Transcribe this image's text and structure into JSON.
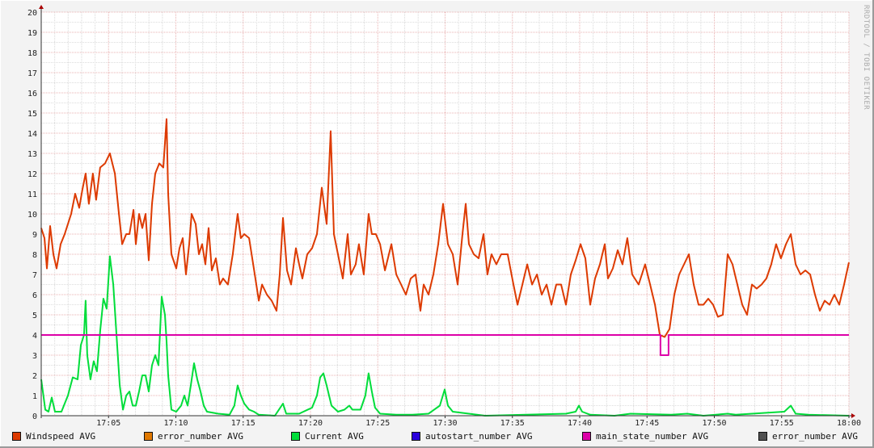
{
  "watermark": "RRDTOOL / TOBI OETIKER",
  "colors": {
    "windspeed": "#dd3a00",
    "error_number_1": "#e07800",
    "current": "#00dd3a",
    "autostart": "#2a00dd",
    "main_state": "#dd00a8",
    "error_number_2": "#505050",
    "background": "#f3f3f3",
    "plot": "#ffffff"
  },
  "legend": [
    {
      "label": "Windspeed AVG",
      "color_key": "windspeed"
    },
    {
      "label": "error_number AVG",
      "color_key": "error_number_1"
    },
    {
      "label": "Current AVG",
      "color_key": "current"
    },
    {
      "label": "autostart_number AVG",
      "color_key": "autostart"
    },
    {
      "label": "main_state_number AVG",
      "color_key": "main_state"
    },
    {
      "label": "error_number AVG",
      "color_key": "error_number_2"
    }
  ],
  "chart_data": {
    "type": "line",
    "title": "",
    "xlabel": "",
    "ylabel": "",
    "x_unit": "minutes after 17:00",
    "xlim": [
      0,
      60
    ],
    "ylim": [
      0,
      20
    ],
    "grid": true,
    "legend_position": "bottom",
    "x_ticks": [
      {
        "t": 5,
        "label": "17:05"
      },
      {
        "t": 10,
        "label": "17:10"
      },
      {
        "t": 15,
        "label": "17:15"
      },
      {
        "t": 20,
        "label": "17:20"
      },
      {
        "t": 25,
        "label": "17:25"
      },
      {
        "t": 30,
        "label": "17:30"
      },
      {
        "t": 35,
        "label": "17:35"
      },
      {
        "t": 40,
        "label": "17:40"
      },
      {
        "t": 45,
        "label": "17:45"
      },
      {
        "t": 50,
        "label": "17:50"
      },
      {
        "t": 55,
        "label": "17:55"
      },
      {
        "t": 60,
        "label": "18:00"
      }
    ],
    "y_ticks": [
      "0",
      "1",
      "2",
      "3",
      "4",
      "5",
      "6",
      "7",
      "8",
      "9",
      "10",
      "11",
      "12",
      "13",
      "14",
      "15",
      "16",
      "17",
      "18",
      "19",
      "20"
    ],
    "series": [
      {
        "name": "Windspeed AVG",
        "color_key": "windspeed",
        "points": [
          [
            0,
            9.3
          ],
          [
            0.24,
            8.8
          ],
          [
            0.42,
            7.3
          ],
          [
            0.66,
            9.4
          ],
          [
            0.9,
            8
          ],
          [
            1.14,
            7.3
          ],
          [
            1.44,
            8.5
          ],
          [
            1.74,
            9
          ],
          [
            2.22,
            10
          ],
          [
            2.52,
            11
          ],
          [
            2.82,
            10.3
          ],
          [
            3.06,
            11.2
          ],
          [
            3.3,
            12
          ],
          [
            3.54,
            10.5
          ],
          [
            3.84,
            12
          ],
          [
            4.08,
            10.7
          ],
          [
            4.38,
            12.3
          ],
          [
            4.74,
            12.5
          ],
          [
            5.1,
            13
          ],
          [
            5.47,
            12
          ],
          [
            5.77,
            10
          ],
          [
            6.01,
            8.5
          ],
          [
            6.31,
            9
          ],
          [
            6.55,
            9
          ],
          [
            6.85,
            10.2
          ],
          [
            7.03,
            8.5
          ],
          [
            7.27,
            10
          ],
          [
            7.51,
            9.3
          ],
          [
            7.75,
            10
          ],
          [
            7.99,
            7.7
          ],
          [
            8.23,
            10.5
          ],
          [
            8.47,
            12
          ],
          [
            8.77,
            12.5
          ],
          [
            9.07,
            12.3
          ],
          [
            9.31,
            14.7
          ],
          [
            9.43,
            11
          ],
          [
            9.67,
            8
          ],
          [
            10.03,
            7.3
          ],
          [
            10.27,
            8.3
          ],
          [
            10.51,
            8.8
          ],
          [
            10.75,
            7
          ],
          [
            10.99,
            8.5
          ],
          [
            11.17,
            10
          ],
          [
            11.47,
            9.5
          ],
          [
            11.71,
            8
          ],
          [
            11.95,
            8.5
          ],
          [
            12.19,
            7.5
          ],
          [
            12.43,
            9.3
          ],
          [
            12.67,
            7.2
          ],
          [
            12.97,
            7.8
          ],
          [
            13.27,
            6.5
          ],
          [
            13.51,
            6.8
          ],
          [
            13.87,
            6.5
          ],
          [
            14.23,
            8
          ],
          [
            14.59,
            10
          ],
          [
            14.83,
            8.8
          ],
          [
            15.08,
            9
          ],
          [
            15.44,
            8.8
          ],
          [
            15.86,
            7
          ],
          [
            16.16,
            5.7
          ],
          [
            16.4,
            6.5
          ],
          [
            16.76,
            6
          ],
          [
            17.12,
            5.7
          ],
          [
            17.48,
            5.2
          ],
          [
            17.72,
            7
          ],
          [
            17.96,
            9.8
          ],
          [
            18.26,
            7.2
          ],
          [
            18.56,
            6.5
          ],
          [
            18.92,
            8.3
          ],
          [
            19.16,
            7.5
          ],
          [
            19.4,
            6.8
          ],
          [
            19.76,
            8
          ],
          [
            20.12,
            8.3
          ],
          [
            20.48,
            9
          ],
          [
            20.84,
            11.3
          ],
          [
            21.2,
            9.5
          ],
          [
            21.5,
            14.1
          ],
          [
            21.74,
            9
          ],
          [
            22.04,
            8
          ],
          [
            22.4,
            6.8
          ],
          [
            22.76,
            9
          ],
          [
            23,
            7
          ],
          [
            23.36,
            7.5
          ],
          [
            23.6,
            8.5
          ],
          [
            23.96,
            7
          ],
          [
            24.32,
            10
          ],
          [
            24.56,
            9
          ],
          [
            24.86,
            9
          ],
          [
            25.17,
            8.5
          ],
          [
            25.53,
            7.2
          ],
          [
            26.01,
            8.5
          ],
          [
            26.37,
            7
          ],
          [
            26.73,
            6.5
          ],
          [
            27.09,
            6
          ],
          [
            27.45,
            6.8
          ],
          [
            27.81,
            7
          ],
          [
            28.17,
            5.2
          ],
          [
            28.41,
            6.5
          ],
          [
            28.77,
            6
          ],
          [
            29.13,
            7
          ],
          [
            29.49,
            8.5
          ],
          [
            29.85,
            10.5
          ],
          [
            30.21,
            8.5
          ],
          [
            30.57,
            8
          ],
          [
            30.93,
            6.5
          ],
          [
            31.29,
            9
          ],
          [
            31.53,
            10.5
          ],
          [
            31.77,
            8.5
          ],
          [
            32.13,
            8
          ],
          [
            32.49,
            7.8
          ],
          [
            32.85,
            9
          ],
          [
            33.15,
            7
          ],
          [
            33.45,
            8
          ],
          [
            33.81,
            7.5
          ],
          [
            34.17,
            8
          ],
          [
            34.65,
            8
          ],
          [
            35.02,
            6.7
          ],
          [
            35.38,
            5.5
          ],
          [
            35.74,
            6.5
          ],
          [
            36.1,
            7.5
          ],
          [
            36.46,
            6.5
          ],
          [
            36.82,
            7
          ],
          [
            37.18,
            6
          ],
          [
            37.54,
            6.5
          ],
          [
            37.9,
            5.5
          ],
          [
            38.26,
            6.5
          ],
          [
            38.62,
            6.5
          ],
          [
            38.98,
            5.5
          ],
          [
            39.34,
            7
          ],
          [
            39.7,
            7.7
          ],
          [
            40.06,
            8.5
          ],
          [
            40.42,
            7.8
          ],
          [
            40.78,
            5.5
          ],
          [
            41.14,
            6.8
          ],
          [
            41.5,
            7.5
          ],
          [
            41.86,
            8.5
          ],
          [
            42.1,
            6.8
          ],
          [
            42.46,
            7.3
          ],
          [
            42.82,
            8.2
          ],
          [
            43.18,
            7.5
          ],
          [
            43.54,
            8.8
          ],
          [
            43.9,
            7
          ],
          [
            44.38,
            6.5
          ],
          [
            44.86,
            7.5
          ],
          [
            45.23,
            6.5
          ],
          [
            45.59,
            5.5
          ],
          [
            45.95,
            4
          ],
          [
            46.31,
            3.9
          ],
          [
            46.67,
            4.3
          ],
          [
            47.03,
            6
          ],
          [
            47.39,
            7
          ],
          [
            47.75,
            7.5
          ],
          [
            48.11,
            8
          ],
          [
            48.47,
            6.5
          ],
          [
            48.83,
            5.5
          ],
          [
            49.19,
            5.5
          ],
          [
            49.55,
            5.8
          ],
          [
            49.91,
            5.5
          ],
          [
            50.27,
            4.9
          ],
          [
            50.63,
            5
          ],
          [
            50.99,
            8
          ],
          [
            51.35,
            7.5
          ],
          [
            51.71,
            6.5
          ],
          [
            52.07,
            5.5
          ],
          [
            52.43,
            5
          ],
          [
            52.79,
            6.5
          ],
          [
            53.15,
            6.3
          ],
          [
            53.51,
            6.5
          ],
          [
            53.87,
            6.8
          ],
          [
            54.23,
            7.5
          ],
          [
            54.59,
            8.5
          ],
          [
            54.95,
            7.8
          ],
          [
            55.32,
            8.5
          ],
          [
            55.68,
            9
          ],
          [
            56.04,
            7.5
          ],
          [
            56.4,
            7
          ],
          [
            56.76,
            7.2
          ],
          [
            57.12,
            7
          ],
          [
            57.48,
            6
          ],
          [
            57.84,
            5.2
          ],
          [
            58.2,
            5.7
          ],
          [
            58.56,
            5.5
          ],
          [
            58.92,
            6
          ],
          [
            59.28,
            5.5
          ],
          [
            59.64,
            6.5
          ],
          [
            60,
            7.6
          ]
        ]
      },
      {
        "name": "Current AVG",
        "color_key": "current",
        "points": [
          [
            0,
            1.8
          ],
          [
            0.3,
            0.3
          ],
          [
            0.54,
            0.2
          ],
          [
            0.78,
            0.9
          ],
          [
            1.02,
            0.2
          ],
          [
            1.5,
            0.2
          ],
          [
            1.98,
            1
          ],
          [
            2.34,
            1.9
          ],
          [
            2.7,
            1.8
          ],
          [
            2.94,
            3.5
          ],
          [
            3.18,
            4
          ],
          [
            3.3,
            5.7
          ],
          [
            3.42,
            3
          ],
          [
            3.66,
            1.8
          ],
          [
            3.9,
            2.7
          ],
          [
            4.14,
            2.2
          ],
          [
            4.38,
            4.2
          ],
          [
            4.62,
            5.8
          ],
          [
            4.86,
            5.3
          ],
          [
            5.1,
            7.9
          ],
          [
            5.35,
            6.5
          ],
          [
            5.59,
            4
          ],
          [
            5.83,
            1.5
          ],
          [
            6.07,
            0.3
          ],
          [
            6.31,
            1
          ],
          [
            6.55,
            1.2
          ],
          [
            6.79,
            0.5
          ],
          [
            7.03,
            0.5
          ],
          [
            7.27,
            1.2
          ],
          [
            7.51,
            2
          ],
          [
            7.75,
            2
          ],
          [
            7.99,
            1.2
          ],
          [
            8.23,
            2.5
          ],
          [
            8.47,
            3
          ],
          [
            8.71,
            2.5
          ],
          [
            8.95,
            5.9
          ],
          [
            9.19,
            5
          ],
          [
            9.31,
            3.7
          ],
          [
            9.43,
            2
          ],
          [
            9.67,
            0.3
          ],
          [
            10.03,
            0.2
          ],
          [
            10.39,
            0.5
          ],
          [
            10.63,
            1
          ],
          [
            10.87,
            0.5
          ],
          [
            11.11,
            1.5
          ],
          [
            11.35,
            2.6
          ],
          [
            11.59,
            1.8
          ],
          [
            11.83,
            1.2
          ],
          [
            12.07,
            0.5
          ],
          [
            12.31,
            0.2
          ],
          [
            13.15,
            0.1
          ],
          [
            13.99,
            0.05
          ],
          [
            14.35,
            0.5
          ],
          [
            14.59,
            1.5
          ],
          [
            14.83,
            1
          ],
          [
            15.08,
            0.6
          ],
          [
            15.44,
            0.3
          ],
          [
            15.8,
            0.2
          ],
          [
            16.16,
            0.05
          ],
          [
            17.36,
            0
          ],
          [
            17.96,
            0.6
          ],
          [
            18.2,
            0.1
          ],
          [
            19.16,
            0.1
          ],
          [
            20.12,
            0.4
          ],
          [
            20.48,
            1
          ],
          [
            20.72,
            1.9
          ],
          [
            20.96,
            2.1
          ],
          [
            21.2,
            1.5
          ],
          [
            21.56,
            0.5
          ],
          [
            22.04,
            0.2
          ],
          [
            22.52,
            0.3
          ],
          [
            22.88,
            0.5
          ],
          [
            23.12,
            0.3
          ],
          [
            23.72,
            0.3
          ],
          [
            24.08,
            1
          ],
          [
            24.32,
            2.1
          ],
          [
            24.56,
            1.2
          ],
          [
            24.8,
            0.4
          ],
          [
            25.17,
            0.1
          ],
          [
            26.37,
            0.05
          ],
          [
            27.57,
            0.05
          ],
          [
            28.77,
            0.1
          ],
          [
            29.61,
            0.5
          ],
          [
            29.97,
            1.3
          ],
          [
            30.21,
            0.5
          ],
          [
            30.57,
            0.2
          ],
          [
            31.77,
            0.1
          ],
          [
            32.97,
            0
          ],
          [
            38.98,
            0.1
          ],
          [
            39.7,
            0.2
          ],
          [
            39.94,
            0.5
          ],
          [
            40.18,
            0.2
          ],
          [
            40.78,
            0.05
          ],
          [
            42.58,
            0
          ],
          [
            43.78,
            0.1
          ],
          [
            46.79,
            0.05
          ],
          [
            47.99,
            0.1
          ],
          [
            49.19,
            0
          ],
          [
            50.99,
            0.1
          ],
          [
            51.59,
            0.05
          ],
          [
            55.2,
            0.2
          ],
          [
            55.68,
            0.5
          ],
          [
            56.04,
            0.1
          ],
          [
            57,
            0.05
          ],
          [
            60,
            0
          ]
        ]
      },
      {
        "name": "main_state_number AVG",
        "color_key": "main_state",
        "step": true,
        "points": [
          [
            0,
            4
          ],
          [
            46.0,
            4
          ],
          [
            46.0,
            3
          ],
          [
            46.6,
            3
          ],
          [
            46.6,
            4
          ],
          [
            60,
            4
          ]
        ]
      }
    ]
  }
}
